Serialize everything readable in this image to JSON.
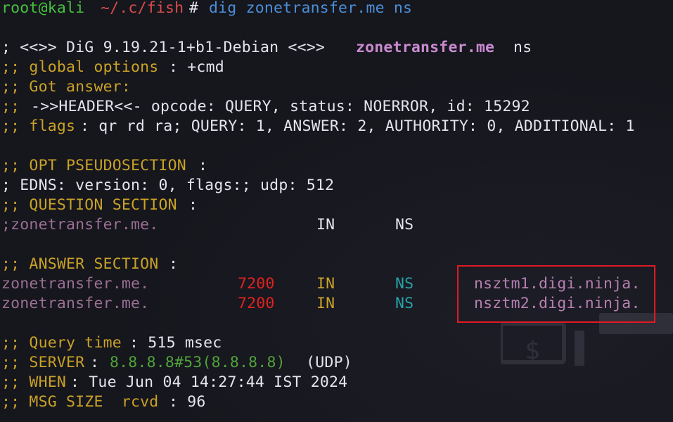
{
  "prompt": {
    "user": "root@kali",
    "path": "~/.c/fish",
    "symbol": "#",
    "command": "dig zonetransfer.me ns"
  },
  "output": {
    "banner_prefix": "; <<>> DiG 9.19.21-1+b1-Debian <<>>",
    "banner_domain": "zonetransfer.me",
    "banner_suffix": "ns",
    "global_options_label": ";; global options",
    "global_options_value": ": +cmd",
    "got_answer": ";; Got answer:",
    "header_prefix": ";;",
    "header_text": "->>HEADER<<- opcode: QUERY, status: NOERROR, id: 15292",
    "flags_label": ";; flags",
    "flags_value": ": qr rd ra; QUERY: 1, ANSWER: 2, AUTHORITY: 0, ADDITIONAL: 1",
    "opt_section_label": ";; OPT PSEUDOSECTION",
    "opt_section_colon": ":",
    "edns_line": "; EDNS: version: 0, flags:; udp: 512",
    "question_section_label": ";; QUESTION SECTION",
    "question_section_colon": ":",
    "question_name": ";zonetransfer.me.",
    "question_class": "IN",
    "question_type": "NS",
    "answer_section_label": ";; ANSWER SECTION",
    "answer_section_colon": ":",
    "answers": [
      {
        "name": "zonetransfer.me.",
        "ttl": "7200",
        "class": "IN",
        "type": "NS",
        "target": "nsztm1.digi.ninja."
      },
      {
        "name": "zonetransfer.me.",
        "ttl": "7200",
        "class": "IN",
        "type": "NS",
        "target": "nsztm2.digi.ninja."
      }
    ],
    "query_time_label": ";; Query time",
    "query_time_value": ": 515 msec",
    "server_label": ";; SERVER",
    "server_colon": ":",
    "server_ip": "8.8.8.8#53(8.8.8.8)",
    "server_proto": " (UDP)",
    "when_label": ";; WHEN",
    "when_value": ": Tue Jun 04 14:27:44 IST 2024",
    "msg_size_label": ";; MSG SIZE  rcvd",
    "msg_size_value": ": 96"
  },
  "colors": {
    "background": "#16161d",
    "highlight": "#e01a22"
  }
}
